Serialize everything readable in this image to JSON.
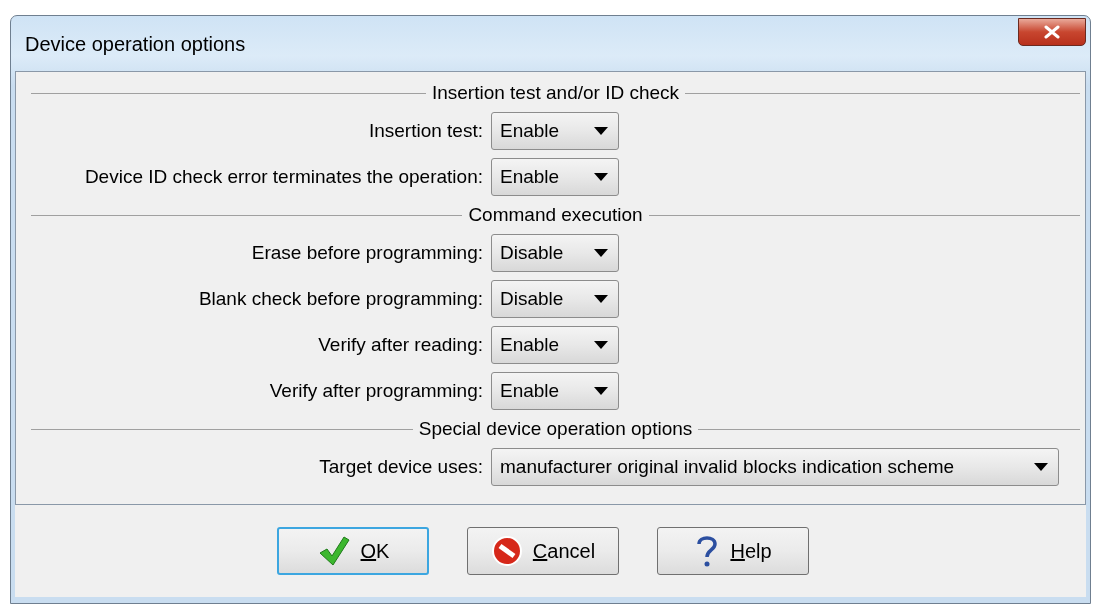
{
  "window": {
    "title": "Device operation options"
  },
  "sections": [
    {
      "heading": "Insertion test and/or ID check",
      "options": [
        {
          "label": "Insertion test:",
          "value": "Enable",
          "kind": "short"
        },
        {
          "label": "Device ID check error terminates the operation:",
          "value": "Enable",
          "kind": "short"
        }
      ]
    },
    {
      "heading": "Command execution",
      "options": [
        {
          "label": "Erase before programming:",
          "value": "Disable",
          "kind": "short"
        },
        {
          "label": "Blank check before programming:",
          "value": "Disable",
          "kind": "short"
        },
        {
          "label": "Verify after reading:",
          "value": "Enable",
          "kind": "short"
        },
        {
          "label": "Verify after programming:",
          "value": "Enable",
          "kind": "short"
        }
      ]
    },
    {
      "heading": "Special device operation options",
      "options": [
        {
          "label": "Target device uses:",
          "value": "manufacturer original invalid blocks indication scheme",
          "kind": "wide"
        }
      ]
    }
  ],
  "buttons": [
    {
      "label": "OK",
      "kind": "ok",
      "default": true
    },
    {
      "label": "Cancel",
      "kind": "cancel",
      "default": false
    },
    {
      "label": "Help",
      "kind": "help",
      "default": false
    }
  ]
}
